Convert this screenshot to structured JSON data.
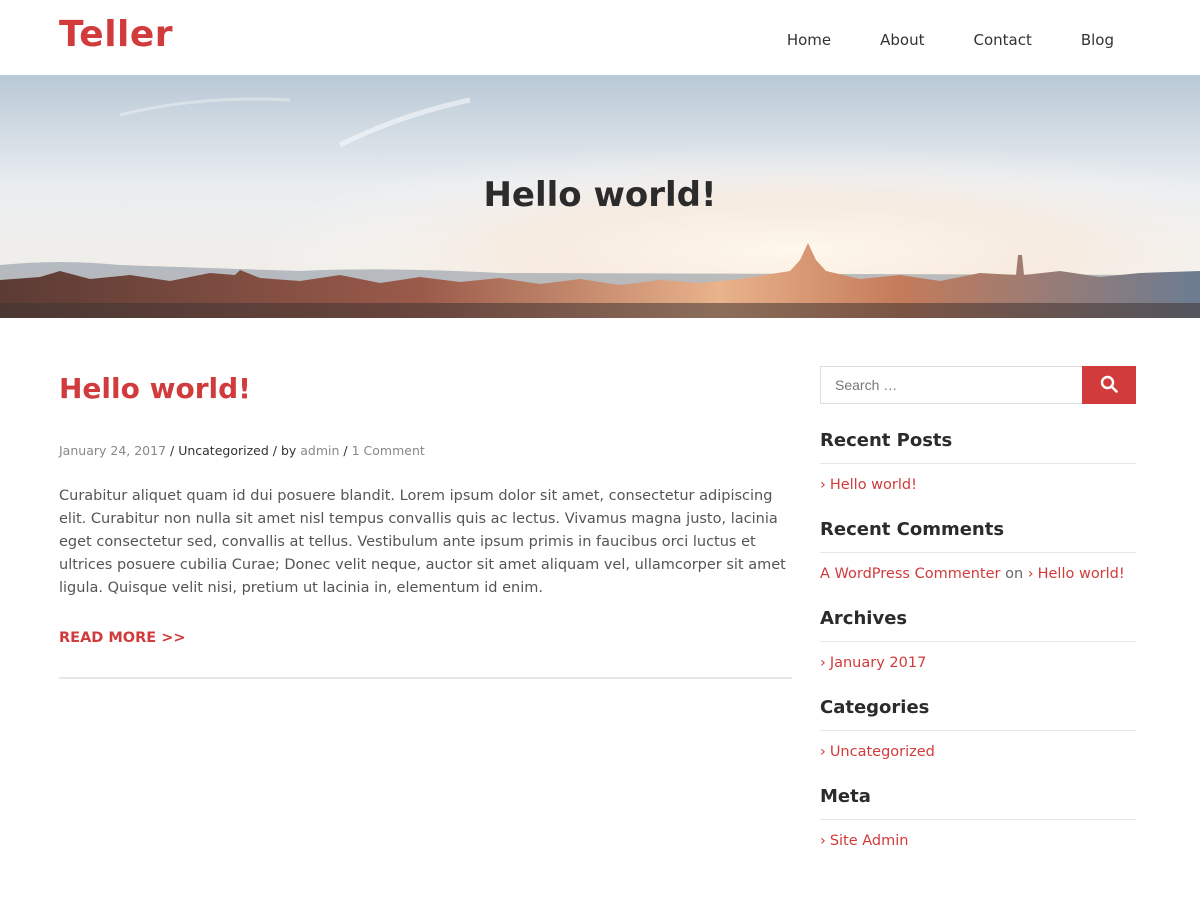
{
  "site": {
    "title": "Teller",
    "accent_color": "#d13b3b"
  },
  "nav": {
    "items": [
      {
        "label": "Home"
      },
      {
        "label": "About"
      },
      {
        "label": "Contact"
      },
      {
        "label": "Blog"
      }
    ]
  },
  "hero": {
    "title": "Hello world!"
  },
  "post": {
    "title": "Hello world!",
    "date": "January 24, 2017",
    "sep1": " / ",
    "category": "Uncategorized",
    "by": " / by ",
    "author": "admin",
    "sep2": " / ",
    "comments": "1 Comment",
    "excerpt": "Curabitur aliquet quam id dui posuere blandit. Lorem ipsum dolor sit amet, consectetur adipiscing elit. Curabitur non nulla sit amet nisl tempus convallis quis ac lectus. Vivamus magna justo, lacinia eget consectetur sed, convallis at tellus. Vestibulum ante ipsum primis in faucibus orci luctus et ultrices posuere cubilia Curae; Donec velit neque, auctor sit amet aliquam vel, ullamcorper sit amet ligula. Quisque velit nisi, pretium ut lacinia in, elementum id enim.",
    "read_more": "READ MORE >>"
  },
  "sidebar": {
    "search": {
      "placeholder": "Search …",
      "icon": "search-icon"
    },
    "recent_posts": {
      "title": "Recent Posts",
      "items": [
        "Hello world!"
      ]
    },
    "recent_comments": {
      "title": "Recent Comments",
      "commenter": "A WordPress Commenter",
      "on": " on ",
      "post": "Hello world!"
    },
    "archives": {
      "title": "Archives",
      "items": [
        "January 2017"
      ]
    },
    "categories": {
      "title": "Categories",
      "items": [
        "Uncategorized"
      ]
    },
    "meta": {
      "title": "Meta",
      "items": [
        "Site Admin"
      ]
    },
    "chevron": "›"
  }
}
